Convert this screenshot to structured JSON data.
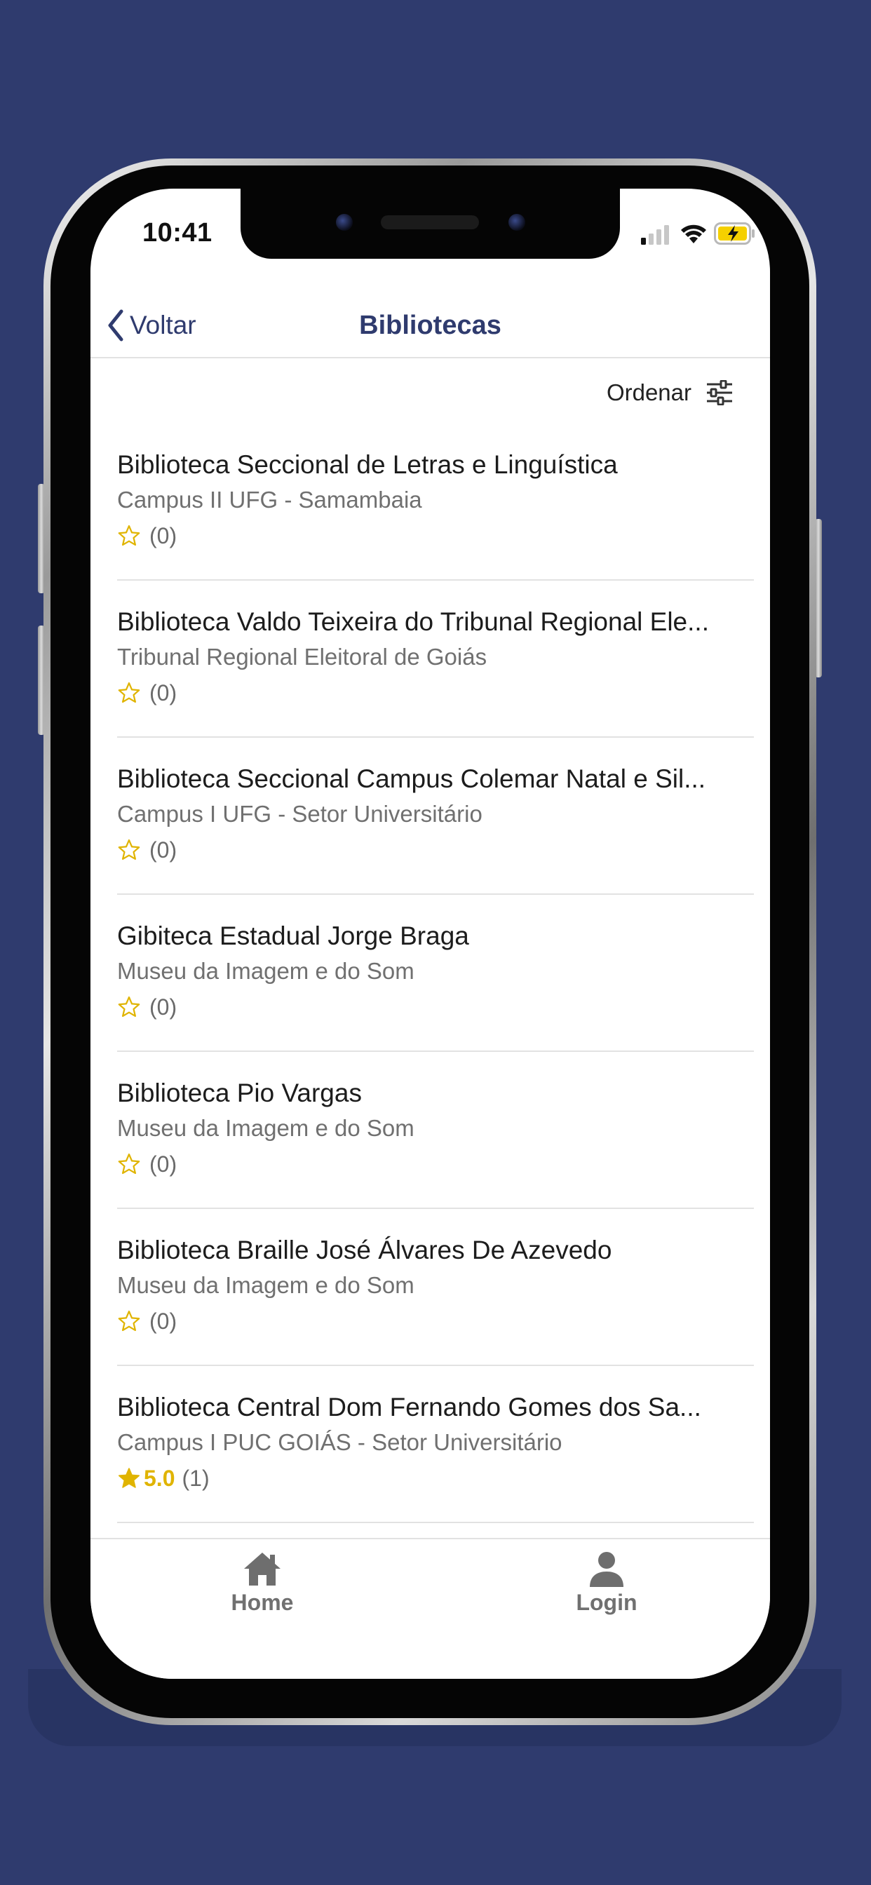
{
  "colors": {
    "background": "#2f3b6e",
    "accent": "#2f3b6e",
    "star": "#e0b400",
    "secondary_text": "#707070"
  },
  "status_bar": {
    "time": "10:41",
    "icons": [
      "cellular-signal-icon",
      "wifi-icon",
      "battery-charging-icon"
    ]
  },
  "nav": {
    "back_label": "Voltar",
    "title": "Bibliotecas"
  },
  "sort": {
    "label": "Ordenar",
    "icon": "sliders-icon"
  },
  "libraries": [
    {
      "name": "Biblioteca Seccional de Letras e Linguística",
      "location": "Campus II UFG - Samambaia",
      "rating": "",
      "rating_count": "(0)",
      "rated": false
    },
    {
      "name": "Biblioteca Valdo Teixeira do Tribunal Regional Ele...",
      "location": "Tribunal Regional Eleitoral de Goiás",
      "rating": "",
      "rating_count": "(0)",
      "rated": false
    },
    {
      "name": "Biblioteca Seccional Campus Colemar Natal e Sil...",
      "location": "Campus I UFG - Setor Universitário",
      "rating": "",
      "rating_count": "(0)",
      "rated": false
    },
    {
      "name": "Gibiteca Estadual Jorge Braga",
      "location": "Museu da Imagem e do Som",
      "rating": "",
      "rating_count": "(0)",
      "rated": false
    },
    {
      "name": "Biblioteca Pio Vargas",
      "location": "Museu da Imagem e do Som",
      "rating": "",
      "rating_count": "(0)",
      "rated": false
    },
    {
      "name": "Biblioteca Braille José Álvares De Azevedo",
      "location": "Museu da Imagem e do Som",
      "rating": "",
      "rating_count": "(0)",
      "rated": false
    },
    {
      "name": "Biblioteca Central Dom Fernando Gomes dos Sa...",
      "location": "Campus I PUC GOIÁS - Setor Universitário",
      "rating": "5.0",
      "rating_count": "(1)",
      "rated": true
    }
  ],
  "tab_bar": {
    "home_label": "Home",
    "home_icon": "home-icon",
    "login_label": "Login",
    "login_icon": "user-icon"
  }
}
